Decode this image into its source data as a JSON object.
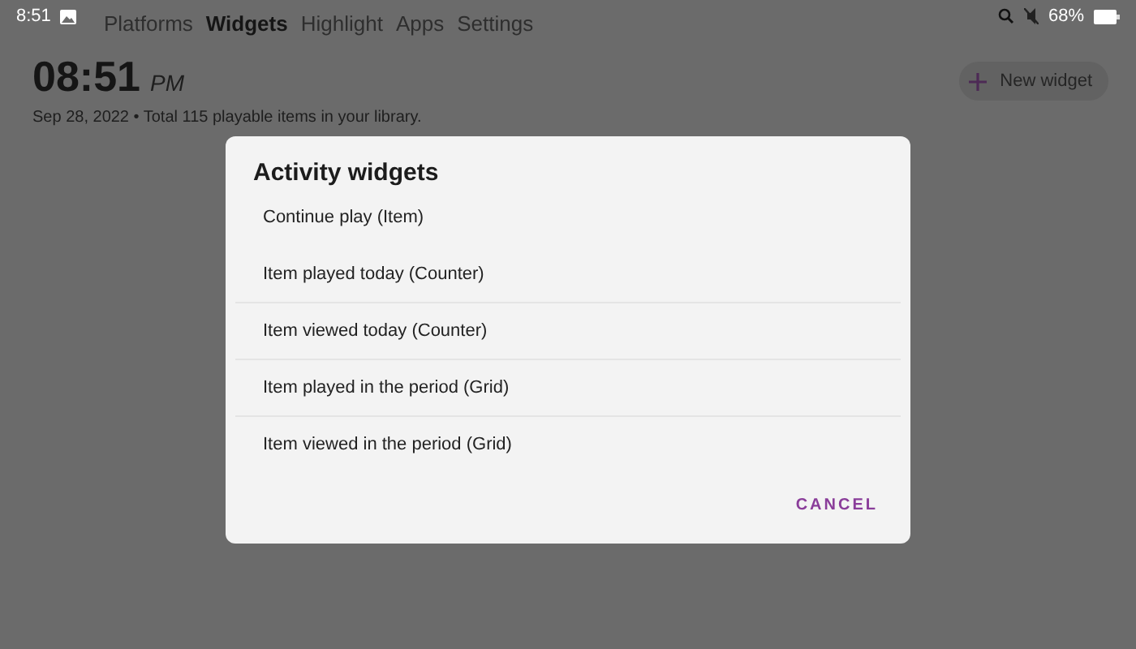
{
  "status_bar": {
    "time": "8:51",
    "battery": "68%"
  },
  "tabs": [
    {
      "label": "Platforms",
      "selected": false
    },
    {
      "label": "Widgets",
      "selected": true
    },
    {
      "label": "Highlight",
      "selected": false
    },
    {
      "label": "Apps",
      "selected": false
    },
    {
      "label": "Settings",
      "selected": false
    }
  ],
  "clock": {
    "time": "08:51",
    "period": "PM"
  },
  "summary": "Sep 28, 2022 • Total 115 playable items in your library.",
  "new_widget_button": {
    "label": "New widget"
  },
  "dialog": {
    "title": "Activity widgets",
    "items": [
      {
        "label": "Continue play (Item)",
        "divider": false
      },
      {
        "label": "Item played today (Counter)",
        "divider": true
      },
      {
        "label": "Item viewed today (Counter)",
        "divider": true
      },
      {
        "label": "Item played in the period (Grid)",
        "divider": true
      },
      {
        "label": "Item viewed in the period (Grid)",
        "divider": false
      }
    ],
    "cancel_button": "CANCEL"
  }
}
